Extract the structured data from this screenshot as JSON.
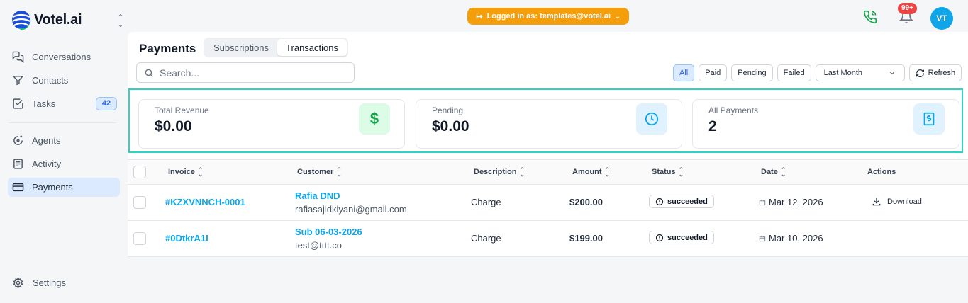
{
  "brand": {
    "name": "Votel.ai"
  },
  "sidebar": {
    "items": [
      {
        "label": "Conversations",
        "icon": "chat-icon"
      },
      {
        "label": "Contacts",
        "icon": "filter-funnel-icon"
      },
      {
        "label": "Tasks",
        "icon": "checkbox-icon",
        "count": "42"
      },
      {
        "label": "Agents",
        "icon": "agent-sparkle-icon"
      },
      {
        "label": "Activity",
        "icon": "activity-list-icon"
      },
      {
        "label": "Payments",
        "icon": "credit-card-icon",
        "active": true
      }
    ],
    "settings_label": "Settings"
  },
  "topbar": {
    "login_text": "Logged in as: templates@votel.ai",
    "notification_count": "99+",
    "avatar_initials": "VT"
  },
  "page": {
    "title": "Payments",
    "tabs": [
      {
        "label": "Subscriptions"
      },
      {
        "label": "Transactions",
        "active": true
      }
    ],
    "search_placeholder": "Search...",
    "filters": {
      "all": "All",
      "paid": "Paid",
      "pending": "Pending",
      "failed": "Failed",
      "period": "Last Month",
      "refresh": "Refresh"
    }
  },
  "stats": [
    {
      "label": "Total Revenue",
      "value": "$0.00",
      "icon": "dollar-icon",
      "color": "#16a34a",
      "bg": "#dcfce7"
    },
    {
      "label": "Pending",
      "value": "$0.00",
      "icon": "clock-icon",
      "color": "#0ea5e9",
      "bg": "#e0f2fe"
    },
    {
      "label": "All Payments",
      "value": "2",
      "icon": "receipt-icon",
      "color": "#0ea5e9",
      "bg": "#e0f2fe"
    }
  ],
  "table": {
    "headers": {
      "invoice": "Invoice",
      "customer": "Customer",
      "description": "Description",
      "amount": "Amount",
      "status": "Status",
      "date": "Date",
      "actions": "Actions"
    },
    "rows": [
      {
        "invoice": "#KZXVNNCH-0001",
        "customer_name": "Rafia DND",
        "customer_email": "rafiasajidkiyani@gmail.com",
        "description": "Charge",
        "amount": "$200.00",
        "status": "succeeded",
        "date": "Mar 12, 2026",
        "action": "Download"
      },
      {
        "invoice": "#0DtkrA1I",
        "customer_name": "Sub 06-03-2026",
        "customer_email": "test@tttt.co",
        "description": "Charge",
        "amount": "$199.00",
        "status": "succeeded",
        "date": "Mar 10, 2026",
        "action": ""
      }
    ]
  }
}
